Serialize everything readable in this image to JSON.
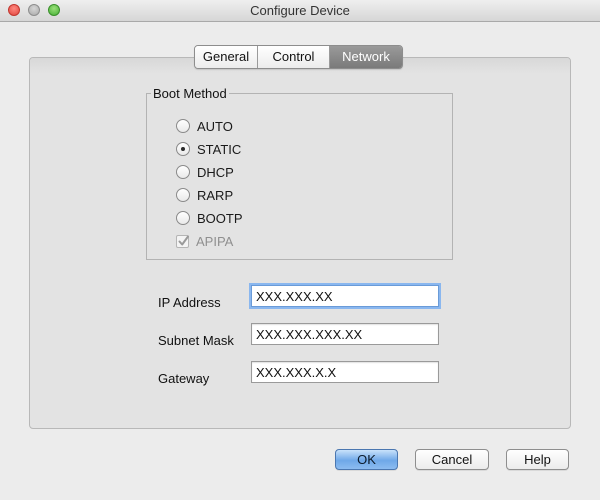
{
  "window": {
    "title": "Configure Device"
  },
  "tabs": [
    {
      "label": "General",
      "selected": false
    },
    {
      "label": "Control",
      "selected": false
    },
    {
      "label": "Network",
      "selected": true
    }
  ],
  "boot_method": {
    "legend": "Boot Method",
    "options": [
      {
        "label": "AUTO",
        "checked": false
      },
      {
        "label": "STATIC",
        "checked": true
      },
      {
        "label": "DHCP",
        "checked": false
      },
      {
        "label": "RARP",
        "checked": false
      },
      {
        "label": "BOOTP",
        "checked": false
      }
    ],
    "apipa": {
      "label": "APIPA",
      "checked": true,
      "enabled": false
    }
  },
  "fields": {
    "ip_address": {
      "label": "IP Address",
      "value": "XXX.XXX.XX"
    },
    "subnet_mask": {
      "label": "Subnet Mask",
      "value": "XXX.XXX.XXX.XX"
    },
    "gateway": {
      "label": "Gateway",
      "value": "XXX.XXX.X.X"
    }
  },
  "buttons": {
    "ok": "OK",
    "cancel": "Cancel",
    "help": "Help"
  }
}
